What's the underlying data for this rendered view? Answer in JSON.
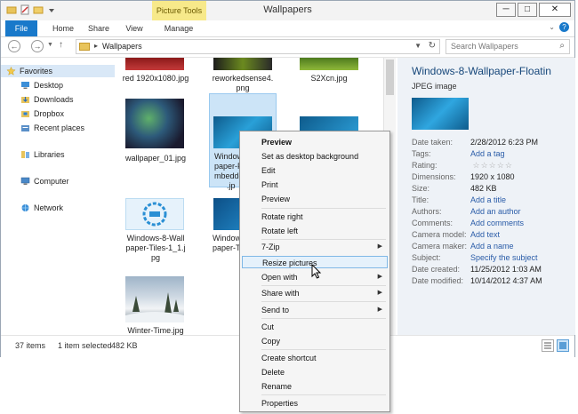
{
  "window": {
    "title": "Wallpapers",
    "contextual_tab": "Picture Tools",
    "buttons": {
      "minimize": "─",
      "maximize": "□",
      "close": "✕"
    }
  },
  "ribbon": {
    "tabs": [
      "File",
      "Home",
      "Share",
      "View",
      "Manage"
    ]
  },
  "address": {
    "crumb": "Wallpapers",
    "search_placeholder": "Search Wallpapers"
  },
  "navpane": {
    "favorites": "Favorites",
    "desktop": "Desktop",
    "downloads": "Downloads",
    "dropbox": "Dropbox",
    "recent": "Recent places",
    "libraries": "Libraries",
    "computer": "Computer",
    "network": "Network"
  },
  "files": [
    {
      "name": "red 1920x1080.jpg"
    },
    {
      "name": "reworkedsense4.png"
    },
    {
      "name": "S2Xcn.jpg"
    },
    {
      "name": "wallpaper_01.jpg"
    },
    {
      "name": "Windows-8-Wallpaper-Floating-Embedded.jpg",
      "display": "Window… paper-F… mbedde… .jp"
    },
    {
      "name": ""
    },
    {
      "name": "Windows-8-Wallpaper-Tiles-1_1.jpg"
    },
    {
      "name": "Window… paper-T…"
    },
    {
      "name": "Winter-Time.jpg"
    }
  ],
  "file_labels": {
    "f0": "red 1920x1080.jpg",
    "f1": "reworkedsense4.",
    "f1b": "png",
    "f2": "S2Xcn.jpg",
    "f3": "wallpaper_01.jpg",
    "f4a": "Window",
    "f4b": "paper-F",
    "f4c": "mbedde",
    "f4d": ".jp",
    "f6a": "Windows-8-Wall",
    "f6b": "paper-Tiles-1_1.j",
    "f6c": "pg",
    "f7a": "Window",
    "f7b": "paper-T",
    "f8": "Winter-Time.jpg"
  },
  "preview": {
    "title": "Windows-8-Wallpaper-Floatin",
    "type": "JPEG image",
    "props": [
      {
        "k": "Date taken:",
        "v": "2/28/2012 6:23 PM",
        "link": false
      },
      {
        "k": "Tags:",
        "v": "Add a tag",
        "link": true
      },
      {
        "k": "Rating:",
        "v": "",
        "link": false
      },
      {
        "k": "Dimensions:",
        "v": "1920 x 1080",
        "link": false
      },
      {
        "k": "Size:",
        "v": "482 KB",
        "link": false
      },
      {
        "k": "Title:",
        "v": "Add a title",
        "link": true
      },
      {
        "k": "Authors:",
        "v": "Add an author",
        "link": true
      },
      {
        "k": "Comments:",
        "v": "Add comments",
        "link": true
      },
      {
        "k": "Camera model:",
        "v": "Add text",
        "link": true
      },
      {
        "k": "Camera maker:",
        "v": "Add a name",
        "link": true
      },
      {
        "k": "Subject:",
        "v": "Specify the subject",
        "link": true
      },
      {
        "k": "Date created:",
        "v": "11/25/2012 1:03 AM",
        "link": false
      },
      {
        "k": "Date modified:",
        "v": "10/14/2012 4:37 AM",
        "link": false
      }
    ]
  },
  "status": {
    "count": "37 items",
    "selected": "1 item selected",
    "size": "482 KB"
  },
  "context_menu": {
    "preview_bold": "Preview",
    "set_bg": "Set as desktop background",
    "edit": "Edit",
    "print": "Print",
    "preview": "Preview",
    "rotate_right": "Rotate right",
    "rotate_left": "Rotate left",
    "zip": "7-Zip",
    "resize": "Resize pictures",
    "open_with": "Open with",
    "share_with": "Share with",
    "send_to": "Send to",
    "cut": "Cut",
    "copy": "Copy",
    "create_shortcut": "Create shortcut",
    "delete": "Delete",
    "rename": "Rename",
    "properties": "Properties"
  },
  "colors": {
    "accent": "#1979ca",
    "selection": "#cce4f7",
    "picture_tools": "#f7e98a"
  }
}
